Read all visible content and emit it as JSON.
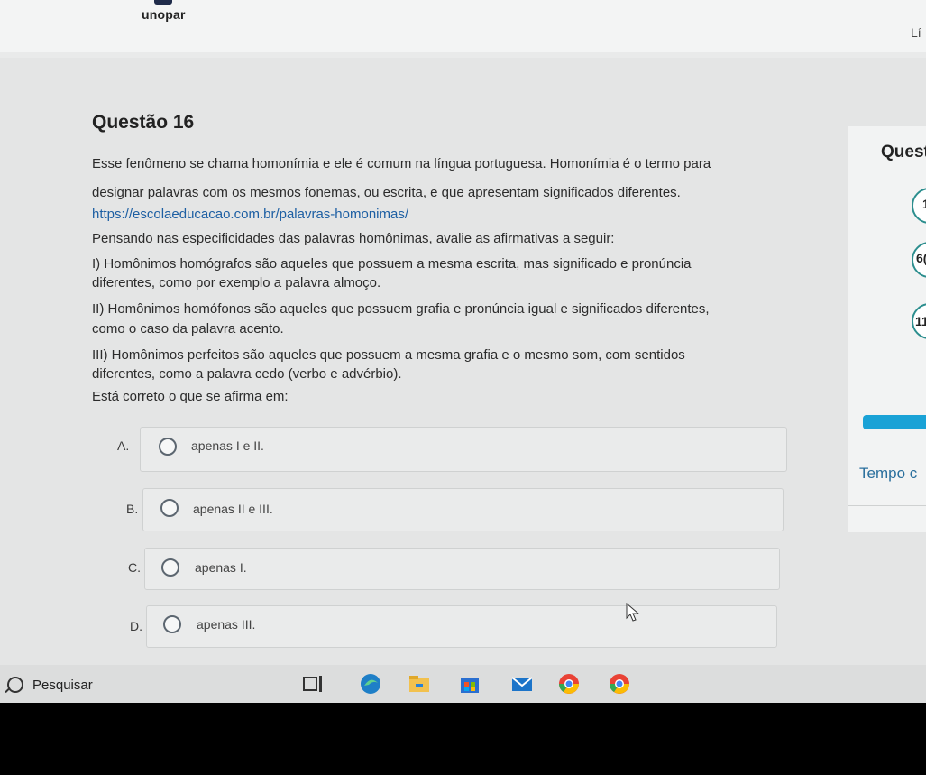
{
  "header": {
    "brand": "unopar",
    "corner_text": "Lí"
  },
  "question": {
    "title": "Questão 16",
    "paragraph_lines": [
      "Esse fenômeno se chama homonímia e ele é comum na língua portuguesa. Homonímia é o termo para",
      "designar palavras com os mesmos fonemas, ou escrita, e que apresentam significados diferentes."
    ],
    "link": "https://escolaeducacao.com.br/palavras-homonimas/",
    "prompt": "Pensando nas especificidades das palavras homônimas, avalie as afirmativas a seguir:",
    "item1_lines": [
      "I) Homônimos homógrafos são aqueles que possuem a mesma escrita, mas significado e pronúncia",
      "diferentes, como por exemplo a palavra almoço."
    ],
    "item2_lines": [
      "II) Homônimos homófonos são aqueles que possuem grafia e pronúncia igual e significados diferentes,",
      "como o caso da palavra acento."
    ],
    "item3_lines": [
      "III) Homônimos perfeitos são aqueles que possuem a mesma grafia e o mesmo som, com sentidos",
      "diferentes, como a palavra cedo (verbo e advérbio)."
    ],
    "closing": "Está correto o que se afirma em:"
  },
  "options": [
    {
      "letter": "A.",
      "label": "apenas I e II."
    },
    {
      "letter": "B.",
      "label": "apenas II e III."
    },
    {
      "letter": "C.",
      "label": "apenas I."
    },
    {
      "letter": "D.",
      "label": "apenas III."
    }
  ],
  "side_panel": {
    "title": "Quest",
    "numbers": [
      "1",
      "6(",
      "11"
    ],
    "tempo": "Tempo c",
    "progress_color": "#1aa2d6"
  },
  "taskbar": {
    "search_label": "Pesquisar"
  }
}
